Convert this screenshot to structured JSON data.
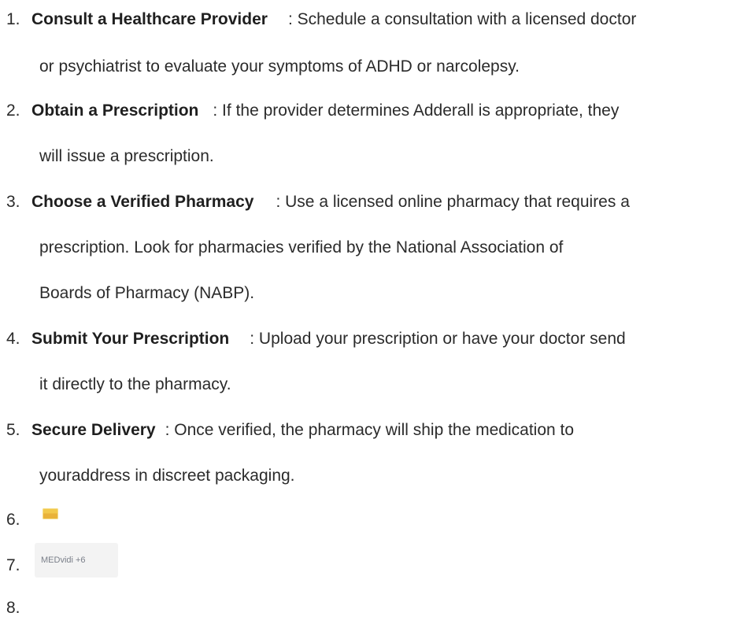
{
  "items": [
    {
      "number": "1.",
      "heading": "Consult a Healthcare Provider",
      "first_line": ": Schedule a consultation with a licensed doctor",
      "continuation": [
        "or psychiatrist to evaluate your symptoms of ADHD or narcolepsy."
      ]
    },
    {
      "number": "2.",
      "heading": "Obtain a Prescription",
      "first_line": ": If the provider determines Adderall is appropriate, they",
      "continuation": [
        "will issue a prescription."
      ]
    },
    {
      "number": "3.",
      "heading": "Choose a Verified Pharmacy",
      "first_line": ": Use a licensed online pharmacy that requires a",
      "continuation": [
        "prescription. Look for pharmacies verified by the National Association of",
        "Boards of Pharmacy (NABP)."
      ]
    },
    {
      "number": "4.",
      "heading": "Submit Your Prescription",
      "first_line": ": Upload your prescription or have your doctor send",
      "continuation": [
        "it directly to the pharmacy."
      ]
    },
    {
      "number": "5.",
      "heading": "Secure Delivery",
      "first_line": ": Once verified, the pharmacy will ship the medication to",
      "continuation": [
        "youraddress in discreet packaging."
      ]
    },
    {
      "number": "6."
    },
    {
      "number": "7.",
      "source_label": "MEDvidi +6"
    },
    {
      "number": "8."
    }
  ],
  "icons": {
    "item6": "yellow-chip-icon"
  },
  "colors": {
    "text": "#2b2b2b",
    "chip_bg": "#f3f3f3",
    "chip_text": "#7a7f89",
    "icon_yellow": "#f2c94c"
  }
}
